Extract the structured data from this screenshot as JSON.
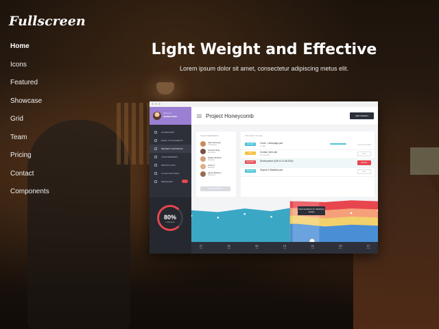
{
  "brand": {
    "logo": "Fullscreen"
  },
  "nav": {
    "items": [
      {
        "label": "Home",
        "active": true
      },
      {
        "label": "Icons"
      },
      {
        "label": "Featured"
      },
      {
        "label": "Showcase"
      },
      {
        "label": "Grid"
      },
      {
        "label": "Team"
      },
      {
        "label": "Pricing"
      },
      {
        "label": "Contact"
      },
      {
        "label": "Components"
      }
    ]
  },
  "hero": {
    "title": "Light Weight and Effective",
    "subtitle": "Lorem ipsum dolor sit amet, consectetur adipiscing metus elit."
  },
  "mockup": {
    "project_title": "Project Honeycomb",
    "add_button": "ADD WIDGET",
    "user": {
      "name": "Welcome",
      "role": "ADMIN PANEL"
    },
    "sidebar": [
      {
        "label": "DASHBOARD",
        "icon": "dashboard-icon"
      },
      {
        "label": "EMAIL ATTACHMENTS",
        "icon": "attachment-icon"
      },
      {
        "label": "PROJECT STATISTICS",
        "icon": "stats-icon",
        "active": true
      },
      {
        "label": "TEAM MEMBERS",
        "icon": "user-icon"
      },
      {
        "label": "REPORT DATA",
        "icon": "report-icon"
      },
      {
        "label": "CLOUD SETTINGS",
        "icon": "folder-icon"
      },
      {
        "label": "MESSAGES",
        "icon": "message-icon",
        "badge": true
      }
    ],
    "gauge": {
      "value": "80%",
      "label": "COMPLETE",
      "fraction": 0.8
    },
    "contacts_title": "TEAM MEMBERS",
    "contacts": [
      {
        "name": "Jack Kennedy",
        "role": "UI Designer",
        "color": "#c98a5a"
      },
      {
        "name": "Antonio Ring",
        "role": "Developer",
        "color": "#7a5040"
      },
      {
        "name": "Sheila Jackson",
        "role": "Designer",
        "color": "#d4a07a"
      },
      {
        "name": "Andy H.",
        "role": "Manager",
        "color": "#e0b08a"
      },
      {
        "name": "Jamie Manson",
        "role": "Marketing",
        "color": "#9a6a50"
      }
    ],
    "contacts_button": "VIEW CONTACTS",
    "files_title": "PROJECT FILES",
    "files": [
      {
        "tag": "UPLOAD",
        "tag_color": "#4fc3d5",
        "name": "Comb - Homepage.psd",
        "meta": "1.2 MB",
        "progress": true,
        "date": "Comb 14.08.2015"
      },
      {
        "tag": "PSD",
        "tag_color": "#f5c342",
        "name": "Contact_form.psd",
        "meta": "Development",
        "button": "View"
      },
      {
        "tag": "DELETED",
        "tag_color": "#e8464f",
        "name": "Development (4:56 to 12.08.2015)",
        "meta": "",
        "button": "Restore",
        "red": true,
        "highlight": true
      },
      {
        "tag": "ARCHIVE",
        "tag_color": "#4fc3d5",
        "name": "Graphs & Statistics.psd",
        "meta": "",
        "button": "View"
      }
    ],
    "chart_data": {
      "type": "area",
      "x": [
        "27",
        "30",
        "06",
        "13",
        "22",
        "09",
        "27"
      ],
      "x_sub": [
        "JUN",
        "JUN",
        "JUL",
        "JUL",
        "JUL",
        "AUG",
        "AUG"
      ],
      "series": [
        {
          "color": "#3aa7c5",
          "values": [
            70,
            66,
            74,
            68,
            78,
            80,
            76,
            82
          ]
        },
        {
          "color": "#e8464f",
          "values": [
            0,
            0,
            0,
            0,
            90,
            88,
            92,
            90
          ]
        },
        {
          "color": "#f5a07a",
          "values": [
            0,
            0,
            0,
            0,
            75,
            70,
            74,
            72
          ]
        },
        {
          "color": "#f2d06b",
          "values": [
            0,
            0,
            0,
            0,
            58,
            52,
            56,
            54
          ]
        },
        {
          "color": "#4a8fd6",
          "values": [
            0,
            0,
            0,
            0,
            40,
            34,
            38,
            36
          ]
        }
      ],
      "tooltip": "Client feedback 14+ Modifying tooltips",
      "ylim": [
        0,
        100
      ]
    }
  }
}
